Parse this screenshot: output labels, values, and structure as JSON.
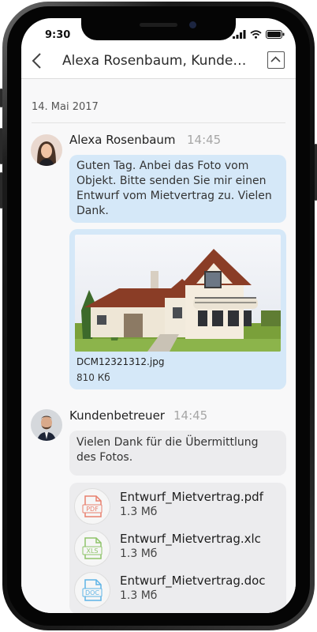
{
  "status_bar": {
    "time": "9:30"
  },
  "header": {
    "title": "Alexa Rosenbaum, Kunden..."
  },
  "chat": {
    "date": "14. Mai 2017",
    "messages": [
      {
        "sender": "Alexa Rosenbaum",
        "time": "14:45",
        "text": "Guten Tag. Anbei das Foto vom Objekt. Bitte senden Sie mir einen Entwurf vom Mietvertrag zu. Vielen Dank.",
        "attachment": {
          "filename": "DCM12321312.jpg",
          "size": "810 Кб"
        }
      },
      {
        "sender": "Kundenbetreuer",
        "time": "14:45",
        "text": "Vielen Dank für die Übermittlung des Fotos.",
        "files": [
          {
            "name": "Entwurf_Mietvertrag.pdf",
            "size": "1.3 Мб",
            "type": "PDF",
            "color": "#e8806e"
          },
          {
            "name": "Entwurf_Mietvertrag.xlc",
            "size": "1.3 Мб",
            "type": "XLS",
            "color": "#8fc46a"
          },
          {
            "name": "Entwurf_Mietvertrag.doc",
            "size": "1.3 Мб",
            "type": "DOC",
            "color": "#5fb4e6"
          }
        ]
      }
    ]
  },
  "colors": {
    "incoming_bubble": "#d5e8f8",
    "outgoing_bubble": "#ececee"
  }
}
